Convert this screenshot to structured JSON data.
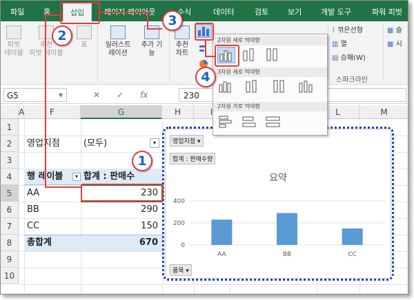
{
  "ribbon": {
    "tabs": [
      "파일",
      "홈",
      "삽입",
      "페이지 레이아웃",
      "수식",
      "데이터",
      "검토",
      "보기",
      "개발 도구",
      "파워 피벗"
    ],
    "active_tab": "삽입",
    "buttons": {
      "pivot_table": "피벗\n테이블",
      "recommended_pivot": "추천\n피벗 테이블",
      "table": "표",
      "illustrations": "일러스트\n레이션",
      "addins": "추가 기\n능",
      "recommended_charts": "추천\n차트",
      "line": "꺾은선형",
      "column": "열",
      "winloss": "승패(W)",
      "sheet_partial": "슬",
      "sheet_partial2": "시"
    },
    "group_sparkline": "스파크라인"
  },
  "formula_bar": {
    "name_box": "G5",
    "formula": "230",
    "fx": "fx"
  },
  "grid": {
    "columns": [
      "A",
      "F",
      "G",
      "H",
      "I",
      "L",
      "M"
    ],
    "rows": [
      "1",
      "2",
      "3",
      "4",
      "5",
      "6",
      "7",
      "8",
      "9",
      "10"
    ],
    "selected_col": "G",
    "selected_row": "5"
  },
  "pivot": {
    "filter_label": "영업지점",
    "filter_value": "(모두)",
    "row_label": "행 레이블",
    "value_header": "합계 : 판매수",
    "items": [
      {
        "label": "AA",
        "value": "230"
      },
      {
        "label": "BB",
        "value": "290"
      },
      {
        "label": "CC",
        "value": "150"
      }
    ],
    "total_label": "총합계",
    "total_value": "670"
  },
  "gallery": {
    "section_2d_column": "2차원 세로 막대형",
    "section_3d_column": "3차원 세로 막대형",
    "section_2d_bar": "2차원 가로 막대형"
  },
  "chart": {
    "filter_button": "영업지점 ▾",
    "value_button": "합계 : 판매수량",
    "axis_button": "품목 ▾",
    "title": "요약"
  },
  "chart_data": {
    "type": "bar",
    "title": "요약",
    "categories": [
      "AA",
      "BB",
      "CC"
    ],
    "values": [
      230,
      290,
      150
    ],
    "yticks": [
      "0",
      "200",
      "400"
    ],
    "ylim": [
      0,
      400
    ],
    "grid": true,
    "bar_color": "#5b9bd5"
  },
  "annotations": [
    "1",
    "2",
    "3",
    "4"
  ],
  "colors": {
    "excel_green": "#217346",
    "annotation_red": "#e53b3b",
    "annotation_blue": "#1f3fbf"
  }
}
